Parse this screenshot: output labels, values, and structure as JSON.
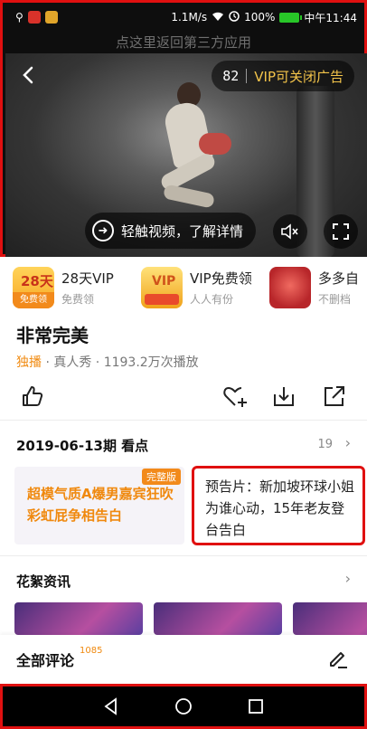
{
  "status_bar": {
    "speed": "1.1M/s",
    "battery": "100%",
    "time": "中午11:44",
    "colors": {
      "battery": "#28c628"
    }
  },
  "return_banner": "点这里返回第三方应用",
  "video": {
    "countdown": "82",
    "vip_close_ad": "VIP可关闭广告",
    "touch_label": "轻触视频，了解详情"
  },
  "promos": [
    {
      "title": "28天VIP",
      "subtitle": "免费领",
      "thumb_text": "免费领"
    },
    {
      "title": "VIP免费领",
      "subtitle": "人人有份",
      "thumb_text": "VIP"
    },
    {
      "title": "多多自",
      "subtitle": "不删档"
    }
  ],
  "show": {
    "title": "非常完美",
    "exclusive": "独播",
    "meta_rest": " · 真人秀 · 1193.2万次播放"
  },
  "episode_section": {
    "title": "2019-06-13期 看点",
    "count": "19",
    "highlight_badge": "完整版",
    "highlight_text": "超模气质A爆男嘉宾狂吹彩虹屁争相告白",
    "preview_text": "预告片：新加坡环球小姐为谁心动，15年老友登台告白"
  },
  "news_section": {
    "title": "花絮资讯"
  },
  "comments": {
    "label": "全部评论",
    "count": "1085"
  },
  "colors": {
    "accent": "#f0890e",
    "highlight_border": "#e01010",
    "vip_gold": "#f3c44a"
  }
}
